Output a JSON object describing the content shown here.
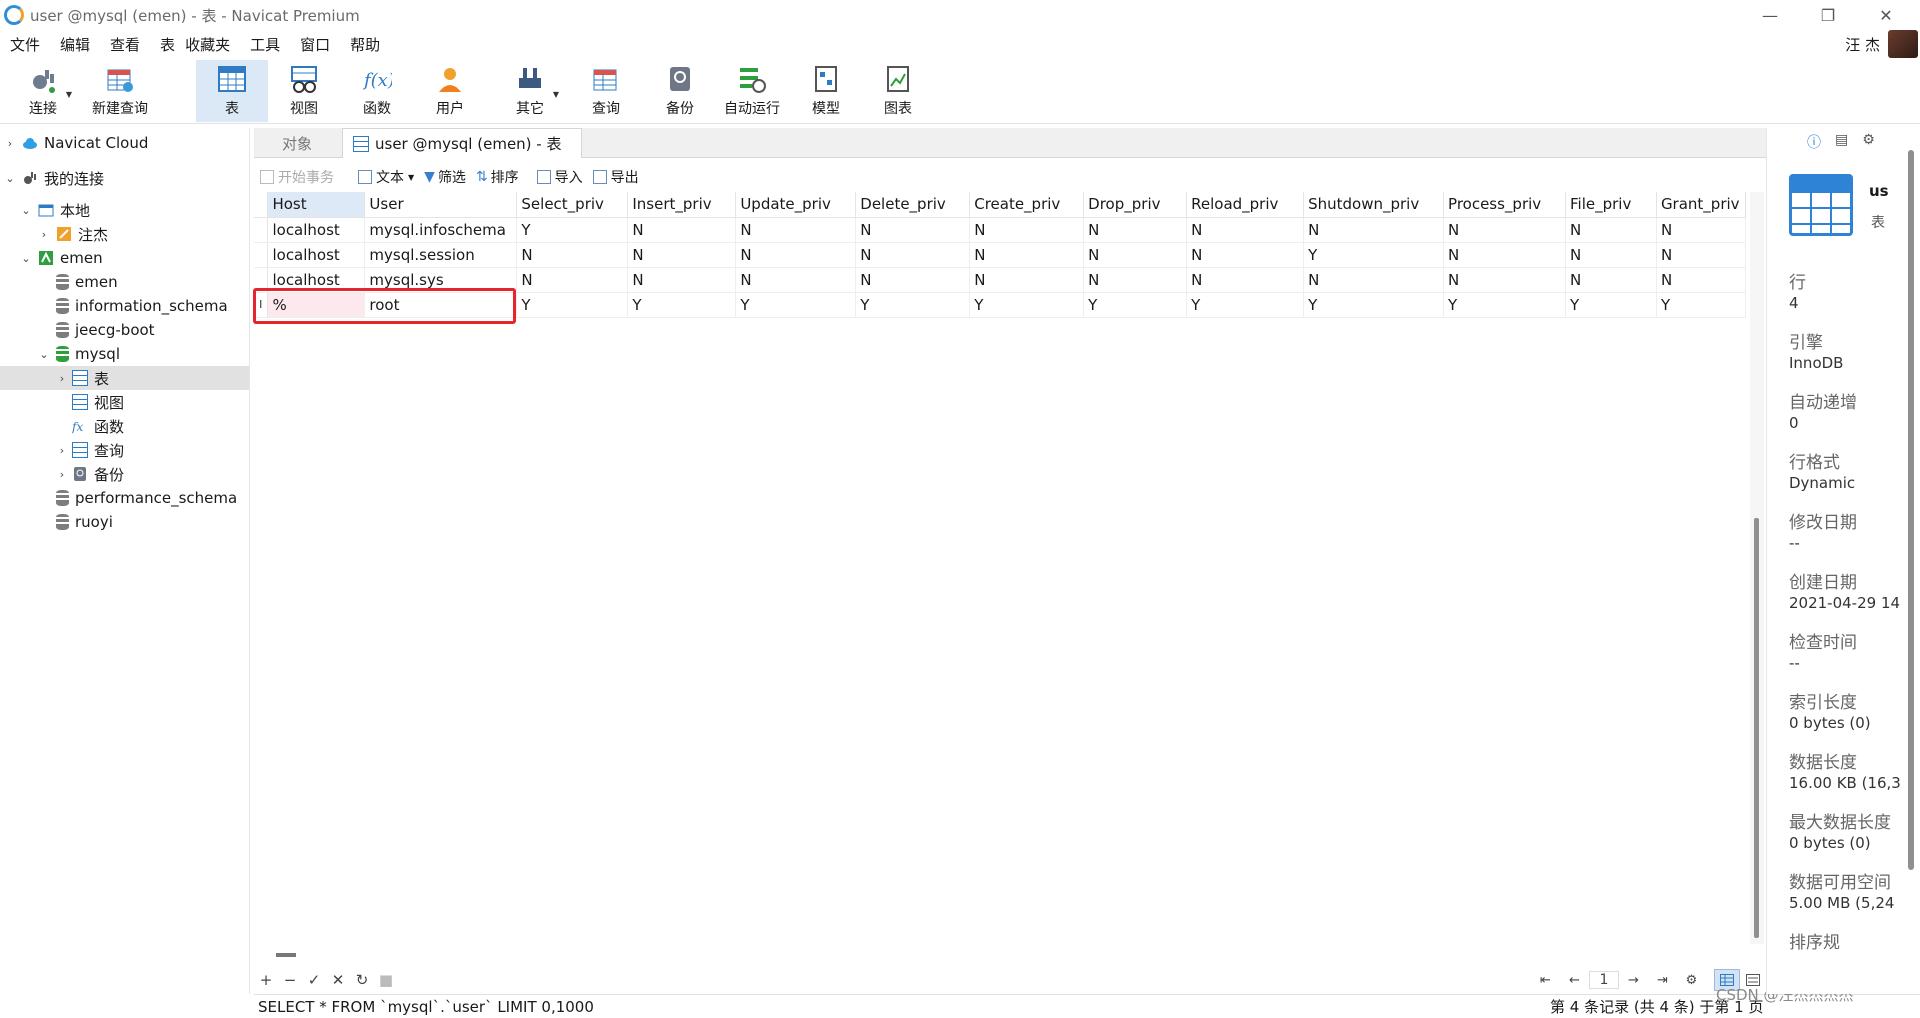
{
  "window": {
    "title": "user @mysql (emen) - 表 - Navicat Premium"
  },
  "menu": [
    "文件",
    "编辑",
    "查看",
    "表",
    "收藏夹",
    "工具",
    "窗口",
    "帮助"
  ],
  "user_name": "汪 杰",
  "toolbar": [
    {
      "label": "连接",
      "icon": "plug-icon"
    },
    {
      "label": "新建查询",
      "icon": "new-query-icon"
    },
    {
      "label": "表",
      "icon": "table-icon"
    },
    {
      "label": "视图",
      "icon": "view-icon"
    },
    {
      "label": "函数",
      "icon": "function-icon"
    },
    {
      "label": "用户",
      "icon": "user-icon"
    },
    {
      "label": "其它",
      "icon": "tools-icon"
    },
    {
      "label": "查询",
      "icon": "query-icon"
    },
    {
      "label": "备份",
      "icon": "backup-icon"
    },
    {
      "label": "自动运行",
      "icon": "schedule-icon"
    },
    {
      "label": "模型",
      "icon": "model-icon"
    },
    {
      "label": "图表",
      "icon": "chart-icon"
    }
  ],
  "sidebar": {
    "items": [
      {
        "label": "Navicat Cloud"
      },
      {
        "label": "我的连接"
      },
      {
        "label": "本地"
      },
      {
        "label": "注杰"
      },
      {
        "label": "emen"
      },
      {
        "label": "emen"
      },
      {
        "label": "information_schema"
      },
      {
        "label": "jeecg-boot"
      },
      {
        "label": "mysql"
      },
      {
        "label": "表"
      },
      {
        "label": "视图"
      },
      {
        "label": "函数"
      },
      {
        "label": "查询"
      },
      {
        "label": "备份"
      },
      {
        "label": "performance_schema"
      },
      {
        "label": "ruoyi"
      }
    ]
  },
  "tabs": {
    "objects": "对象",
    "active": "user @mysql (emen) - 表"
  },
  "subtoolbar": {
    "begin_tx": "开始事务",
    "text": "文本",
    "filter": "筛选",
    "sort": "排序",
    "import": "导入",
    "export": "导出"
  },
  "grid": {
    "columns": [
      "Host",
      "User",
      "Select_priv",
      "Insert_priv",
      "Update_priv",
      "Delete_priv",
      "Create_priv",
      "Drop_priv",
      "Reload_priv",
      "Shutdown_priv",
      "Process_priv",
      "File_priv",
      "Grant_priv"
    ],
    "rows": [
      [
        "localhost",
        "mysql.infoschema",
        "Y",
        "N",
        "N",
        "N",
        "N",
        "N",
        "N",
        "N",
        "N",
        "N",
        "N"
      ],
      [
        "localhost",
        "mysql.session",
        "N",
        "N",
        "N",
        "N",
        "N",
        "N",
        "N",
        "Y",
        "N",
        "N",
        "N"
      ],
      [
        "localhost",
        "mysql.sys",
        "N",
        "N",
        "N",
        "N",
        "N",
        "N",
        "N",
        "N",
        "N",
        "N",
        "N"
      ],
      [
        "%",
        "root",
        "Y",
        "Y",
        "Y",
        "Y",
        "Y",
        "Y",
        "Y",
        "Y",
        "Y",
        "Y",
        "Y"
      ]
    ],
    "edit_cursor": "I"
  },
  "pager": {
    "page": "1"
  },
  "status": {
    "sql": "SELECT * FROM `mysql`.`user` LIMIT 0,1000",
    "records": "第 4 条记录 (共 4 条) 于第 1 页"
  },
  "watermark": "CSDN @汪杰杰杰杰",
  "info": {
    "name": "us",
    "type": "表",
    "fields": [
      {
        "label": "行",
        "value": "4"
      },
      {
        "label": "引擎",
        "value": "InnoDB"
      },
      {
        "label": "自动递增",
        "value": "0"
      },
      {
        "label": "行格式",
        "value": "Dynamic"
      },
      {
        "label": "修改日期",
        "value": "--"
      },
      {
        "label": "创建日期",
        "value": "2021-04-29 14"
      },
      {
        "label": "检查时间",
        "value": "--"
      },
      {
        "label": "索引长度",
        "value": "0 bytes (0)"
      },
      {
        "label": "数据长度",
        "value": "16.00 KB (16,3"
      },
      {
        "label": "最大数据长度",
        "value": "0 bytes (0)"
      },
      {
        "label": "数据可用空间",
        "value": "5.00 MB (5,24"
      },
      {
        "label": "排序规",
        "value": ""
      }
    ]
  },
  "colors": {
    "accent": "#2f83d6",
    "highlight": "#e3262f",
    "selected_bg": "#dbe9f7"
  }
}
